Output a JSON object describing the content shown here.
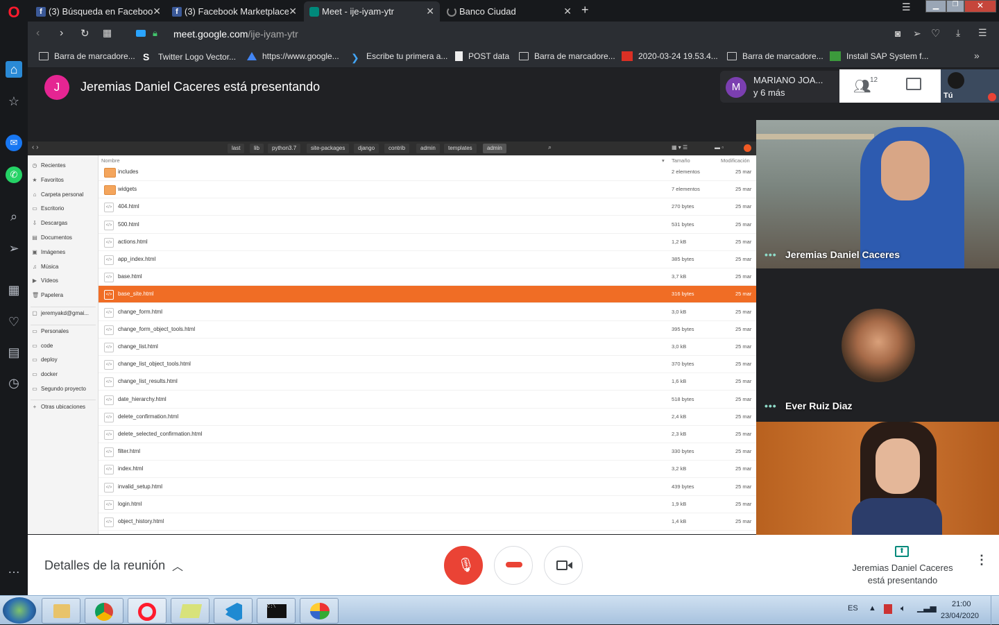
{
  "tabs": [
    {
      "title": "(3) Búsqueda en Facebook",
      "favicon": "facebook-icon"
    },
    {
      "title": "(3) Facebook Marketplace",
      "favicon": "facebook-icon"
    },
    {
      "title": "Meet - ije-iyam-ytr",
      "favicon": "meet-icon"
    },
    {
      "title": "Banco Ciudad",
      "favicon": "loading-icon"
    }
  ],
  "address": {
    "domain": "meet.google.com",
    "path": "/ije-iyam-ytr"
  },
  "bookmarks": [
    {
      "label": "Barra de marcadore...",
      "icon": "folder-icon"
    },
    {
      "label": "Twitter Logo Vector...",
      "icon": "s-logo-icon"
    },
    {
      "label": "https://www.google...",
      "icon": "drive-icon"
    },
    {
      "label": "Escribe tu primera a...",
      "icon": "flutter-icon"
    },
    {
      "label": "POST data",
      "icon": "document-icon"
    },
    {
      "label": "Barra de marcadore...",
      "icon": "folder-icon"
    },
    {
      "label": "2020-03-24 19.53.4...",
      "icon": "video-icon"
    },
    {
      "label": "Barra de marcadore...",
      "icon": "folder-icon"
    },
    {
      "label": "Install SAP System f...",
      "icon": "sap-icon"
    }
  ],
  "meet": {
    "presenter_initial": "J",
    "presenting_text": "Jeremias Daniel Caceres está presentando",
    "participant_initial": "M",
    "participant_name": "MARIANO JOA...",
    "participant_more": "y 6 más",
    "people_count": "12",
    "self_label": "Tú",
    "tiles": [
      {
        "name": "Jeremias Daniel Caceres"
      },
      {
        "name": "Ever Ruiz Diaz"
      }
    ],
    "details_label": "Detalles de la reunión",
    "presenting_footer_line1": "Jeremias Daniel Caceres",
    "presenting_footer_line2": "está presentando"
  },
  "colors": {
    "accent_orange": "#f06d25",
    "end_call": "#ea4335",
    "meet_bg": "#202124"
  },
  "nautilus": {
    "path": [
      "last",
      "lib",
      "python3.7",
      "site-packages",
      "django",
      "contrib",
      "admin",
      "templates",
      "admin"
    ],
    "sidebar": [
      {
        "label": "Recientes",
        "icon": "clock-icon"
      },
      {
        "label": "Favoritos",
        "icon": "star-icon"
      },
      {
        "label": "Carpeta personal",
        "icon": "home-icon"
      },
      {
        "label": "Escritorio",
        "icon": "desktop-icon"
      },
      {
        "label": "Descargas",
        "icon": "download-icon"
      },
      {
        "label": "Documentos",
        "icon": "document-icon"
      },
      {
        "label": "Imágenes",
        "icon": "image-icon"
      },
      {
        "label": "Música",
        "icon": "music-icon"
      },
      {
        "label": "Vídeos",
        "icon": "video-icon"
      },
      {
        "label": "Papelera",
        "icon": "trash-icon"
      },
      {
        "label": "jeremyakd@gmai...",
        "icon": "account-icon"
      },
      {
        "label": "Personales",
        "icon": "folder-icon"
      },
      {
        "label": "code",
        "icon": "folder-icon"
      },
      {
        "label": "deploy",
        "icon": "folder-icon"
      },
      {
        "label": "docker",
        "icon": "folder-icon"
      },
      {
        "label": "Segundo proyecto",
        "icon": "folder-icon"
      },
      {
        "label": "Otras ubicaciones",
        "icon": "plus-icon"
      }
    ],
    "columns": {
      "name": "Nombre",
      "size": "Tamaño",
      "modified": "Modificación"
    },
    "files": [
      {
        "name": "includes",
        "size": "2 elementos",
        "date": "25 mar",
        "type": "folder"
      },
      {
        "name": "widgets",
        "size": "7 elementos",
        "date": "25 mar",
        "type": "folder"
      },
      {
        "name": "404.html",
        "size": "270 bytes",
        "date": "25 mar",
        "type": "html"
      },
      {
        "name": "500.html",
        "size": "531 bytes",
        "date": "25 mar",
        "type": "html"
      },
      {
        "name": "actions.html",
        "size": "1,2 kB",
        "date": "25 mar",
        "type": "html"
      },
      {
        "name": "app_index.html",
        "size": "385 bytes",
        "date": "25 mar",
        "type": "html"
      },
      {
        "name": "base.html",
        "size": "3,7 kB",
        "date": "25 mar",
        "type": "html"
      },
      {
        "name": "base_site.html",
        "size": "316 bytes",
        "date": "25 mar",
        "type": "html",
        "selected": true
      },
      {
        "name": "change_form.html",
        "size": "3,0 kB",
        "date": "25 mar",
        "type": "html"
      },
      {
        "name": "change_form_object_tools.html",
        "size": "395 bytes",
        "date": "25 mar",
        "type": "html"
      },
      {
        "name": "change_list.html",
        "size": "3,0 kB",
        "date": "25 mar",
        "type": "html"
      },
      {
        "name": "change_list_object_tools.html",
        "size": "370 bytes",
        "date": "25 mar",
        "type": "html"
      },
      {
        "name": "change_list_results.html",
        "size": "1,6 kB",
        "date": "25 mar",
        "type": "html"
      },
      {
        "name": "date_hierarchy.html",
        "size": "518 bytes",
        "date": "25 mar",
        "type": "html"
      },
      {
        "name": "delete_confirmation.html",
        "size": "2,4 kB",
        "date": "25 mar",
        "type": "html"
      },
      {
        "name": "delete_selected_confirmation.html",
        "size": "2,3 kB",
        "date": "25 mar",
        "type": "html"
      },
      {
        "name": "filter.html",
        "size": "330 bytes",
        "date": "25 mar",
        "type": "html"
      },
      {
        "name": "index.html",
        "size": "3,2 kB",
        "date": "25 mar",
        "type": "html"
      },
      {
        "name": "invalid_setup.html",
        "size": "439 bytes",
        "date": "25 mar",
        "type": "html"
      },
      {
        "name": "login.html",
        "size": "1,9 kB",
        "date": "25 mar",
        "type": "html"
      },
      {
        "name": "object_history.html",
        "size": "1,4 kB",
        "date": "25 mar",
        "type": "html"
      }
    ]
  },
  "taskbar": {
    "lang": "ES",
    "time": "21:00",
    "date": "23/04/2020"
  }
}
